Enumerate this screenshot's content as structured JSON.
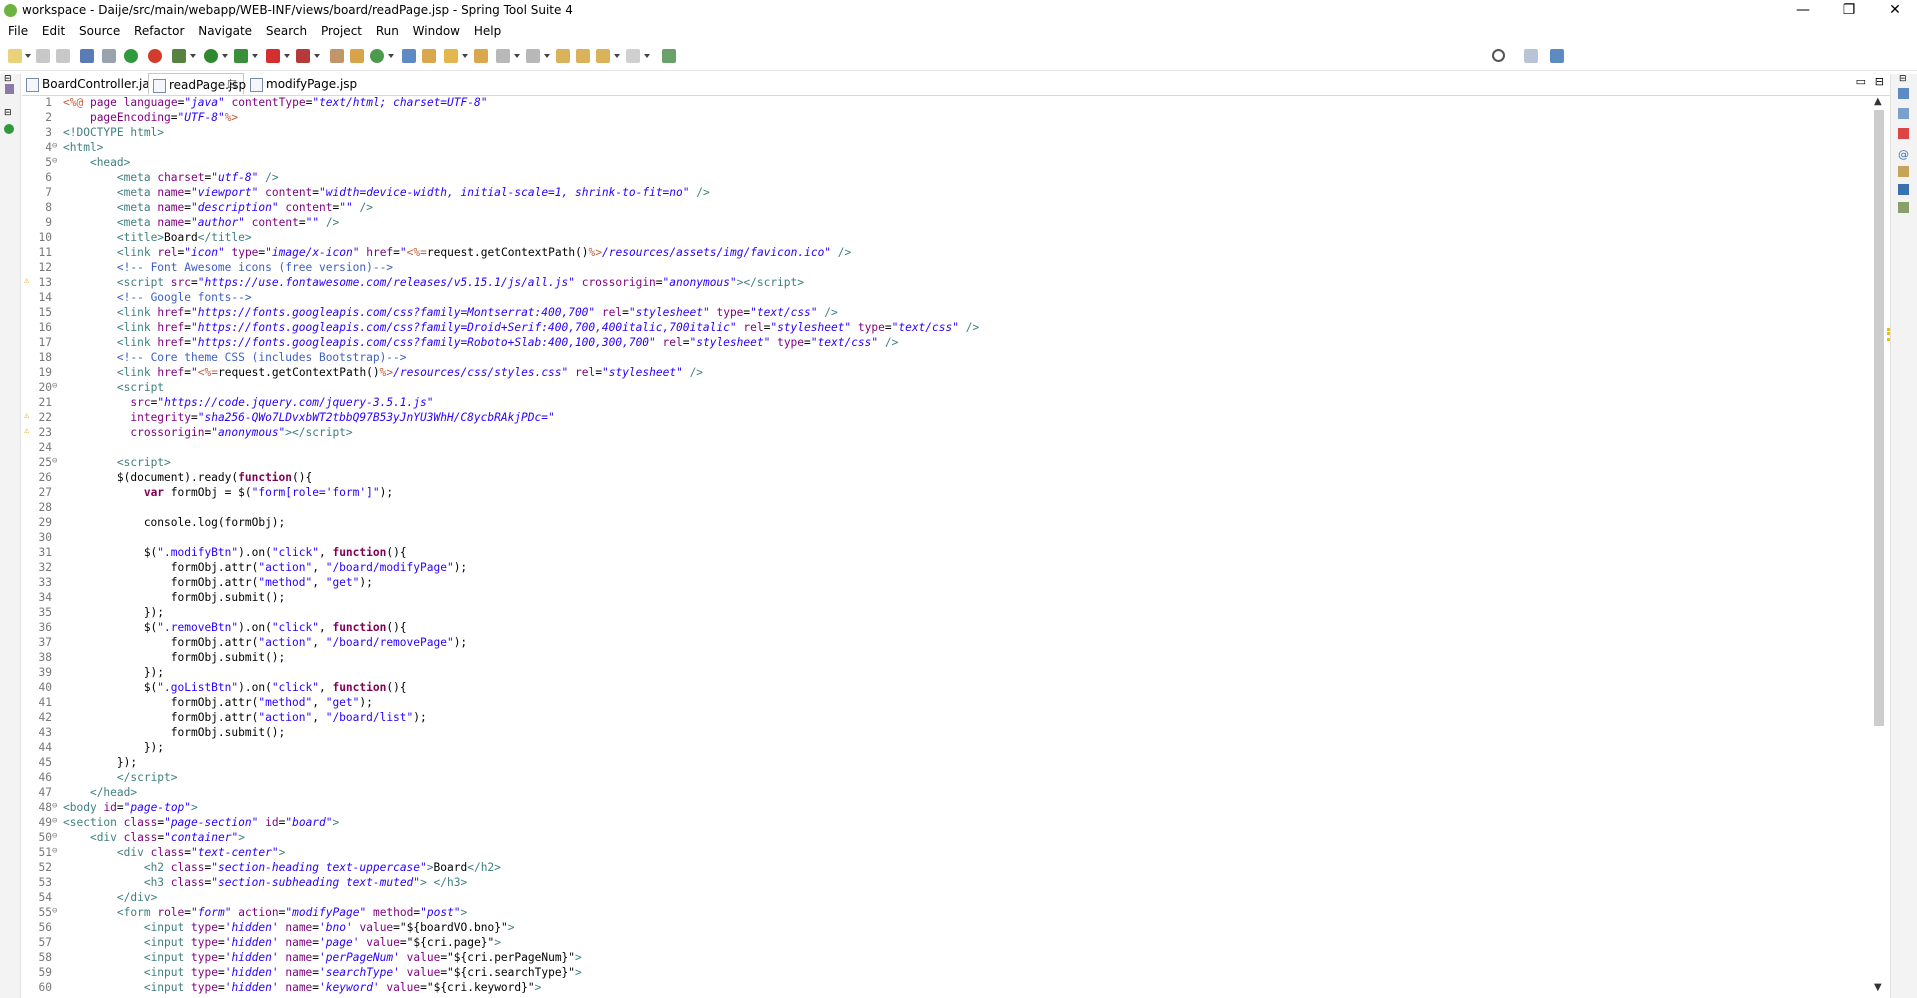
{
  "window": {
    "title": "workspace - Daije/src/main/webapp/WEB-INF/views/board/readPage.jsp - Spring Tool Suite 4",
    "minimize": "—",
    "restore": "❐",
    "close": "✕"
  },
  "menu": [
    "File",
    "Edit",
    "Source",
    "Refactor",
    "Navigate",
    "Search",
    "Project",
    "Run",
    "Window",
    "Help"
  ],
  "tabs": [
    {
      "label": "BoardController.java",
      "active": false
    },
    {
      "label": "readPage.jsp",
      "active": true,
      "close": "☒"
    },
    {
      "label": "modifyPage.jsp",
      "active": false
    }
  ],
  "editor": {
    "lines": [
      {
        "n": "1",
        "warn": false,
        "fold": "",
        "html": "<span class=\"t-jsp\">&lt;%@</span> <span class=\"t-attr\">page</span> <span class=\"t-attr\">language</span>=<span class=\"t-str\">\"java\"</span> <span class=\"t-attr\">contentType</span>=<span class=\"t-str\">\"text/html; charset=UTF-8\"</span>"
      },
      {
        "n": "2",
        "warn": false,
        "fold": "",
        "html": "    <span class=\"t-attr\">pageEncoding</span>=<span class=\"t-str\">\"UTF-8\"</span><span class=\"t-jsp\">%&gt;</span>"
      },
      {
        "n": "3",
        "warn": false,
        "fold": "",
        "html": "<span class=\"t-tag\">&lt;!DOCTYPE html&gt;</span>"
      },
      {
        "n": "4",
        "warn": false,
        "fold": "⊖",
        "html": "<span class=\"t-tag\">&lt;html&gt;</span>"
      },
      {
        "n": "5",
        "warn": false,
        "fold": "⊖",
        "html": "    <span class=\"t-tag\">&lt;head&gt;</span>"
      },
      {
        "n": "6",
        "warn": false,
        "fold": "",
        "html": "        <span class=\"t-tag\">&lt;meta</span> <span class=\"t-attr\">charset</span>=<span class=\"t-str\">\"utf-8\"</span> <span class=\"t-tag\">/&gt;</span>"
      },
      {
        "n": "7",
        "warn": false,
        "fold": "",
        "html": "        <span class=\"t-tag\">&lt;meta</span> <span class=\"t-attr\">name</span>=<span class=\"t-str\">\"viewport\"</span> <span class=\"t-attr\">content</span>=<span class=\"t-str\">\"width=device-width, initial-scale=1, shrink-to-fit=no\"</span> <span class=\"t-tag\">/&gt;</span>"
      },
      {
        "n": "8",
        "warn": false,
        "fold": "",
        "html": "        <span class=\"t-tag\">&lt;meta</span> <span class=\"t-attr\">name</span>=<span class=\"t-str\">\"description\"</span> <span class=\"t-attr\">content</span>=<span class=\"t-str\">\"\"</span> <span class=\"t-tag\">/&gt;</span>"
      },
      {
        "n": "9",
        "warn": false,
        "fold": "",
        "html": "        <span class=\"t-tag\">&lt;meta</span> <span class=\"t-attr\">name</span>=<span class=\"t-str\">\"author\"</span> <span class=\"t-attr\">content</span>=<span class=\"t-str\">\"\"</span> <span class=\"t-tag\">/&gt;</span>"
      },
      {
        "n": "10",
        "warn": false,
        "fold": "",
        "html": "        <span class=\"t-tag\">&lt;title&gt;</span>Board<span class=\"t-tag\">&lt;/title&gt;</span>"
      },
      {
        "n": "11",
        "warn": false,
        "fold": "",
        "html": "        <span class=\"t-tag\">&lt;link</span> <span class=\"t-attr\">rel</span>=<span class=\"t-str\">\"icon\"</span> <span class=\"t-attr\">type</span>=<span class=\"t-str\">\"image/x-icon\"</span> <span class=\"t-attr\">href</span>=<span class=\"t-str\">\"</span><span class=\"t-jsp\">&lt;%=</span>request.getContextPath()<span class=\"t-jsp\">%&gt;</span><span class=\"t-str\">/resources/assets/img/favicon.ico\"</span> <span class=\"t-tag\">/&gt;</span>"
      },
      {
        "n": "12",
        "warn": false,
        "fold": "",
        "html": "        <span class=\"t-com\">&lt;!-- Font Awesome icons (free version)--&gt;</span>"
      },
      {
        "n": "13",
        "warn": true,
        "fold": "",
        "html": "        <span class=\"t-tag\">&lt;script</span> <span class=\"t-attr\">src</span>=<span class=\"t-str\">\"https://use.fontawesome.com/releases/v5.15.1/js/all.js\"</span> <span class=\"t-attr\">crossorigin</span>=<span class=\"t-str\">\"anonymous\"</span><span class=\"t-tag\">&gt;&lt;/script&gt;</span>"
      },
      {
        "n": "14",
        "warn": false,
        "fold": "",
        "html": "        <span class=\"t-com\">&lt;!-- Google fonts--&gt;</span>"
      },
      {
        "n": "15",
        "warn": false,
        "fold": "",
        "html": "        <span class=\"t-tag\">&lt;link</span> <span class=\"t-attr\">href</span>=<span class=\"t-str\">\"https://fonts.googleapis.com/css?family=Montserrat:400,700\"</span> <span class=\"t-attr\">rel</span>=<span class=\"t-str\">\"stylesheet\"</span> <span class=\"t-attr\">type</span>=<span class=\"t-str\">\"text/css\"</span> <span class=\"t-tag\">/&gt;</span>"
      },
      {
        "n": "16",
        "warn": false,
        "fold": "",
        "html": "        <span class=\"t-tag\">&lt;link</span> <span class=\"t-attr\">href</span>=<span class=\"t-str\">\"https://fonts.googleapis.com/css?family=Droid+Serif:400,700,400italic,700italic\"</span> <span class=\"t-attr\">rel</span>=<span class=\"t-str\">\"stylesheet\"</span> <span class=\"t-attr\">type</span>=<span class=\"t-str\">\"text/css\"</span> <span class=\"t-tag\">/&gt;</span>"
      },
      {
        "n": "17",
        "warn": false,
        "fold": "",
        "html": "        <span class=\"t-tag\">&lt;link</span> <span class=\"t-attr\">href</span>=<span class=\"t-str\">\"https://fonts.googleapis.com/css?family=Roboto+Slab:400,100,300,700\"</span> <span class=\"t-attr\">rel</span>=<span class=\"t-str\">\"stylesheet\"</span> <span class=\"t-attr\">type</span>=<span class=\"t-str\">\"text/css\"</span> <span class=\"t-tag\">/&gt;</span>"
      },
      {
        "n": "18",
        "warn": false,
        "fold": "",
        "html": "        <span class=\"t-com\">&lt;!-- Core theme CSS (includes Bootstrap)--&gt;</span>"
      },
      {
        "n": "19",
        "warn": false,
        "fold": "",
        "html": "        <span class=\"t-tag\">&lt;link</span> <span class=\"t-attr\">href</span>=<span class=\"t-str\">\"</span><span class=\"t-jsp\">&lt;%=</span>request.getContextPath()<span class=\"t-jsp\">%&gt;</span><span class=\"t-str\">/resources/css/styles.css\"</span> <span class=\"t-attr\">rel</span>=<span class=\"t-str\">\"stylesheet\"</span> <span class=\"t-tag\">/&gt;</span>"
      },
      {
        "n": "20",
        "warn": false,
        "fold": "⊖",
        "html": "        <span class=\"t-tag\">&lt;script</span>"
      },
      {
        "n": "21",
        "warn": false,
        "fold": "",
        "html": "          <span class=\"t-attr\">src</span>=<span class=\"t-str\">\"https://code.jquery.com/jquery-3.5.1.js\"</span>"
      },
      {
        "n": "22",
        "warn": true,
        "fold": "",
        "html": "          <span class=\"t-attr\">integrity</span>=<span class=\"t-str\">\"sha256-QWo7LDvxbWT2tbbQ97B53yJnYU3WhH/C8ycbRAkjPDc=\"</span>"
      },
      {
        "n": "23",
        "warn": true,
        "fold": "",
        "html": "          <span class=\"t-attr\">crossorigin</span>=<span class=\"t-str\">\"anonymous\"</span><span class=\"t-tag\">&gt;&lt;/script&gt;</span>"
      },
      {
        "n": "24",
        "warn": false,
        "fold": "",
        "html": ""
      },
      {
        "n": "25",
        "warn": false,
        "fold": "⊖",
        "html": "        <span class=\"t-tag\">&lt;script&gt;</span>"
      },
      {
        "n": "26",
        "warn": false,
        "fold": "",
        "html": "        $(document).ready(<span class=\"t-kw\">function</span>(){"
      },
      {
        "n": "27",
        "warn": false,
        "fold": "",
        "html": "            <span class=\"t-kw\">var</span> formObj = $(<span class=\"t-jsstr\">\"form[role='form']\"</span>);"
      },
      {
        "n": "28",
        "warn": false,
        "fold": "",
        "html": ""
      },
      {
        "n": "29",
        "warn": false,
        "fold": "",
        "html": "            console.log(formObj);"
      },
      {
        "n": "30",
        "warn": false,
        "fold": "",
        "html": ""
      },
      {
        "n": "31",
        "warn": false,
        "fold": "",
        "html": "            $(<span class=\"t-jsstr\">\".modifyBtn\"</span>).on(<span class=\"t-jsstr\">\"click\"</span>, <span class=\"t-kw\">function</span>(){"
      },
      {
        "n": "32",
        "warn": false,
        "fold": "",
        "html": "                formObj.attr(<span class=\"t-jsstr\">\"action\"</span>, <span class=\"t-jsstr\">\"/board/modifyPage\"</span>);"
      },
      {
        "n": "33",
        "warn": false,
        "fold": "",
        "html": "                formObj.attr(<span class=\"t-jsstr\">\"method\"</span>, <span class=\"t-jsstr\">\"get\"</span>);"
      },
      {
        "n": "34",
        "warn": false,
        "fold": "",
        "html": "                formObj.submit();"
      },
      {
        "n": "35",
        "warn": false,
        "fold": "",
        "html": "            });"
      },
      {
        "n": "36",
        "warn": false,
        "fold": "",
        "html": "            $(<span class=\"t-jsstr\">\".removeBtn\"</span>).on(<span class=\"t-jsstr\">\"click\"</span>, <span class=\"t-kw\">function</span>(){"
      },
      {
        "n": "37",
        "warn": false,
        "fold": "",
        "html": "                formObj.attr(<span class=\"t-jsstr\">\"action\"</span>, <span class=\"t-jsstr\">\"/board/removePage\"</span>);"
      },
      {
        "n": "38",
        "warn": false,
        "fold": "",
        "html": "                formObj.submit();"
      },
      {
        "n": "39",
        "warn": false,
        "fold": "",
        "html": "            });"
      },
      {
        "n": "40",
        "warn": false,
        "fold": "",
        "html": "            $(<span class=\"t-jsstr\">\".goListBtn\"</span>).on(<span class=\"t-jsstr\">\"click\"</span>, <span class=\"t-kw\">function</span>(){"
      },
      {
        "n": "41",
        "warn": false,
        "fold": "",
        "html": "                formObj.attr(<span class=\"t-jsstr\">\"method\"</span>, <span class=\"t-jsstr\">\"get\"</span>);"
      },
      {
        "n": "42",
        "warn": false,
        "fold": "",
        "html": "                formObj.attr(<span class=\"t-jsstr\">\"action\"</span>, <span class=\"t-jsstr\">\"/board/list\"</span>);"
      },
      {
        "n": "43",
        "warn": false,
        "fold": "",
        "html": "                formObj.submit();"
      },
      {
        "n": "44",
        "warn": false,
        "fold": "",
        "html": "            });"
      },
      {
        "n": "45",
        "warn": false,
        "fold": "",
        "html": "        });"
      },
      {
        "n": "46",
        "warn": false,
        "fold": "",
        "html": "        <span class=\"t-tag\">&lt;/script&gt;</span>"
      },
      {
        "n": "47",
        "warn": false,
        "fold": "",
        "html": "    <span class=\"t-tag\">&lt;/head&gt;</span>"
      },
      {
        "n": "48",
        "warn": false,
        "fold": "⊖",
        "html": "<span class=\"t-tag\">&lt;body</span> <span class=\"t-attr\">id</span>=<span class=\"t-str\">\"page-top\"</span><span class=\"t-tag\">&gt;</span>"
      },
      {
        "n": "49",
        "warn": false,
        "fold": "⊖",
        "html": "<span class=\"t-tag\">&lt;section</span> <span class=\"t-attr\">class</span>=<span class=\"t-str\">\"page-section\"</span> <span class=\"t-attr\">id</span>=<span class=\"t-str\">\"board\"</span><span class=\"t-tag\">&gt;</span>"
      },
      {
        "n": "50",
        "warn": false,
        "fold": "⊖",
        "html": "    <span class=\"t-tag\">&lt;div</span> <span class=\"t-attr\">class</span>=<span class=\"t-str\">\"container\"</span><span class=\"t-tag\">&gt;</span>"
      },
      {
        "n": "51",
        "warn": false,
        "fold": "⊖",
        "html": "        <span class=\"t-tag\">&lt;div</span> <span class=\"t-attr\">class</span>=<span class=\"t-str\">\"text-center\"</span><span class=\"t-tag\">&gt;</span>"
      },
      {
        "n": "52",
        "warn": false,
        "fold": "",
        "html": "            <span class=\"t-tag\">&lt;h2</span> <span class=\"t-attr\">class</span>=<span class=\"t-str\">\"section-heading text-uppercase\"</span><span class=\"t-tag\">&gt;</span>Board<span class=\"t-tag\">&lt;/h2&gt;</span>"
      },
      {
        "n": "53",
        "warn": false,
        "fold": "",
        "html": "            <span class=\"t-tag\">&lt;h3</span> <span class=\"t-attr\">class</span>=<span class=\"t-str\">\"section-subheading text-muted\"</span><span class=\"t-tag\">&gt;</span> <span class=\"t-tag\">&lt;/h3&gt;</span>"
      },
      {
        "n": "54",
        "warn": false,
        "fold": "",
        "html": "        <span class=\"t-tag\">&lt;/div&gt;</span>"
      },
      {
        "n": "55",
        "warn": false,
        "fold": "⊖",
        "html": "        <span class=\"t-tag\">&lt;form</span> <span class=\"t-attr\">role</span>=<span class=\"t-str\">\"form\"</span> <span class=\"t-attr\">action</span>=<span class=\"t-str\">\"modifyPage\"</span> <span class=\"t-attr\">method</span>=<span class=\"t-str\">\"post\"</span><span class=\"t-tag\">&gt;</span>"
      },
      {
        "n": "56",
        "warn": false,
        "fold": "",
        "html": "            <span class=\"t-tag\">&lt;input</span> <span class=\"t-attr\">type</span>=<span class=\"t-str\">'hidden'</span> <span class=\"t-attr\">name</span>=<span class=\"t-str\">'bno'</span> <span class=\"t-attr\">value</span>=\"${boardVO.bno}\"<span class=\"t-tag\">&gt;</span>"
      },
      {
        "n": "57",
        "warn": false,
        "fold": "",
        "html": "            <span class=\"t-tag\">&lt;input</span> <span class=\"t-attr\">type</span>=<span class=\"t-str\">'hidden'</span> <span class=\"t-attr\">name</span>=<span class=\"t-str\">'page'</span> <span class=\"t-attr\">value</span>=\"${cri.page}\"<span class=\"t-tag\">&gt;</span>"
      },
      {
        "n": "58",
        "warn": false,
        "fold": "",
        "html": "            <span class=\"t-tag\">&lt;input</span> <span class=\"t-attr\">type</span>=<span class=\"t-str\">'hidden'</span> <span class=\"t-attr\">name</span>=<span class=\"t-str\">'perPageNum'</span> <span class=\"t-attr\">value</span>=\"${cri.perPageNum}\"<span class=\"t-tag\">&gt;</span>"
      },
      {
        "n": "59",
        "warn": false,
        "fold": "",
        "html": "            <span class=\"t-tag\">&lt;input</span> <span class=\"t-attr\">type</span>=<span class=\"t-str\">'hidden'</span> <span class=\"t-attr\">name</span>=<span class=\"t-str\">'searchType'</span> <span class=\"t-attr\">value</span>=\"${cri.searchType}\"<span class=\"t-tag\">&gt;</span>"
      },
      {
        "n": "60",
        "warn": false,
        "fold": "",
        "html": "            <span class=\"t-tag\">&lt;input</span> <span class=\"t-attr\">type</span>=<span class=\"t-str\">'hidden'</span> <span class=\"t-attr\">name</span>=<span class=\"t-str\">'keyword'</span> <span class=\"t-attr\">value</span>=\"${cri.keyword}\"<span class=\"t-tag\">&gt;</span>"
      }
    ]
  },
  "colors": {
    "warning": "#f0c000",
    "accent": "#6db33f"
  },
  "icons": [
    "app-icon",
    "minimize-icon",
    "restore-icon",
    "close-icon",
    "search-icon",
    "perspective-icon",
    "warning-icon",
    "fold-icon"
  ]
}
